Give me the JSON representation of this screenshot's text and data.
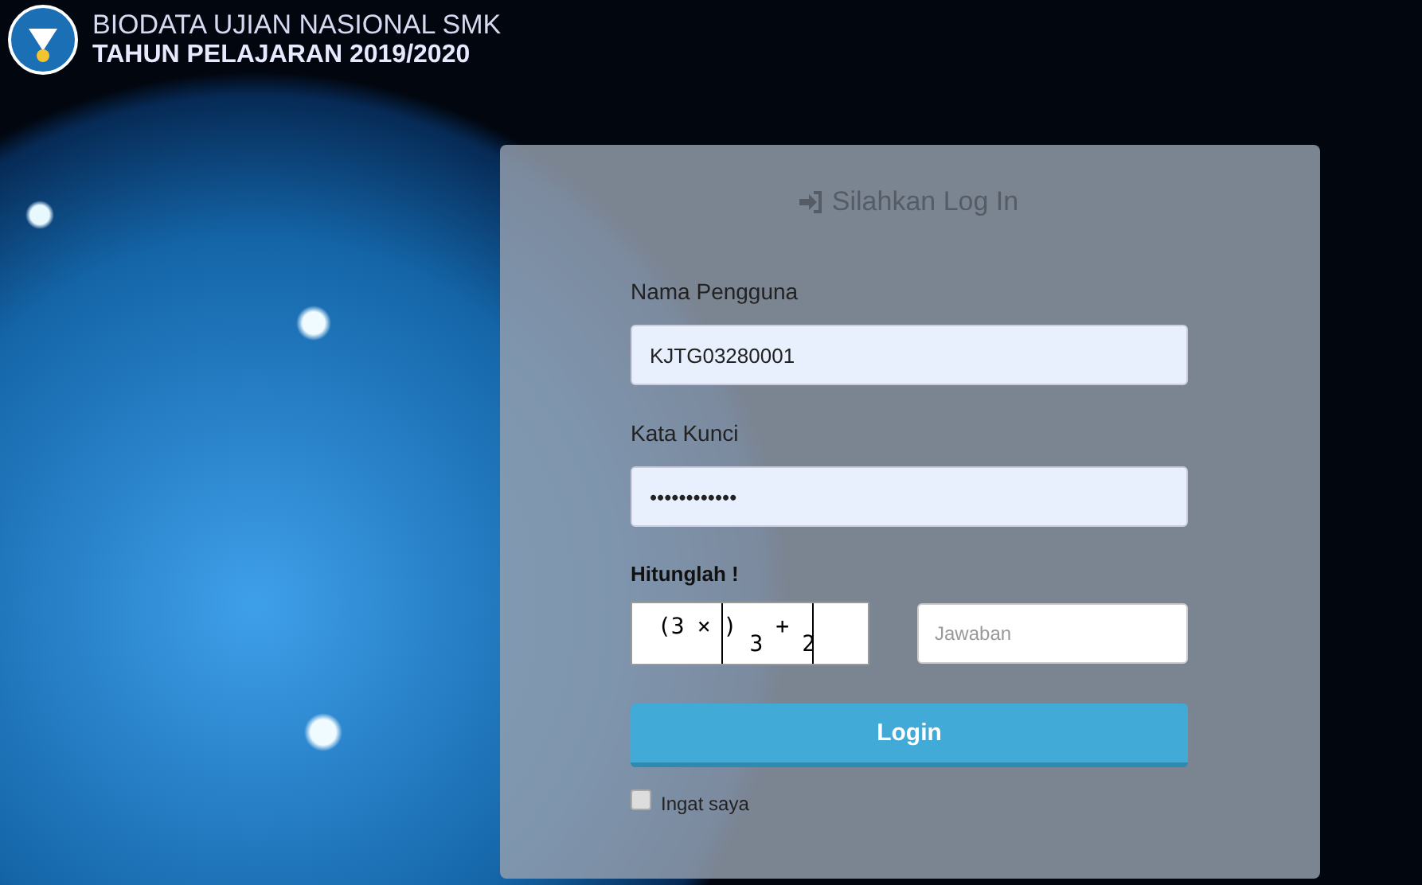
{
  "header": {
    "title": "BIODATA UJIAN NASIONAL SMK",
    "subtitle": "TAHUN PELAJARAN 2019/2020"
  },
  "login": {
    "heading": "Silahkan Log In",
    "fields": [
      {
        "label": "Nama Pengguna",
        "value": "KJTG03280001"
      },
      {
        "label": "Kata Kunci",
        "value": "••••••••••••"
      }
    ],
    "captcha": {
      "label": "Hitunglah !",
      "glyphs": [
        "(3",
        "×",
        ")",
        "3",
        "+",
        "2"
      ],
      "answer": {
        "placeholder": "Jawaban"
      }
    },
    "button": "Login",
    "remember": {
      "label": "Ingat saya",
      "checked": false
    }
  }
}
